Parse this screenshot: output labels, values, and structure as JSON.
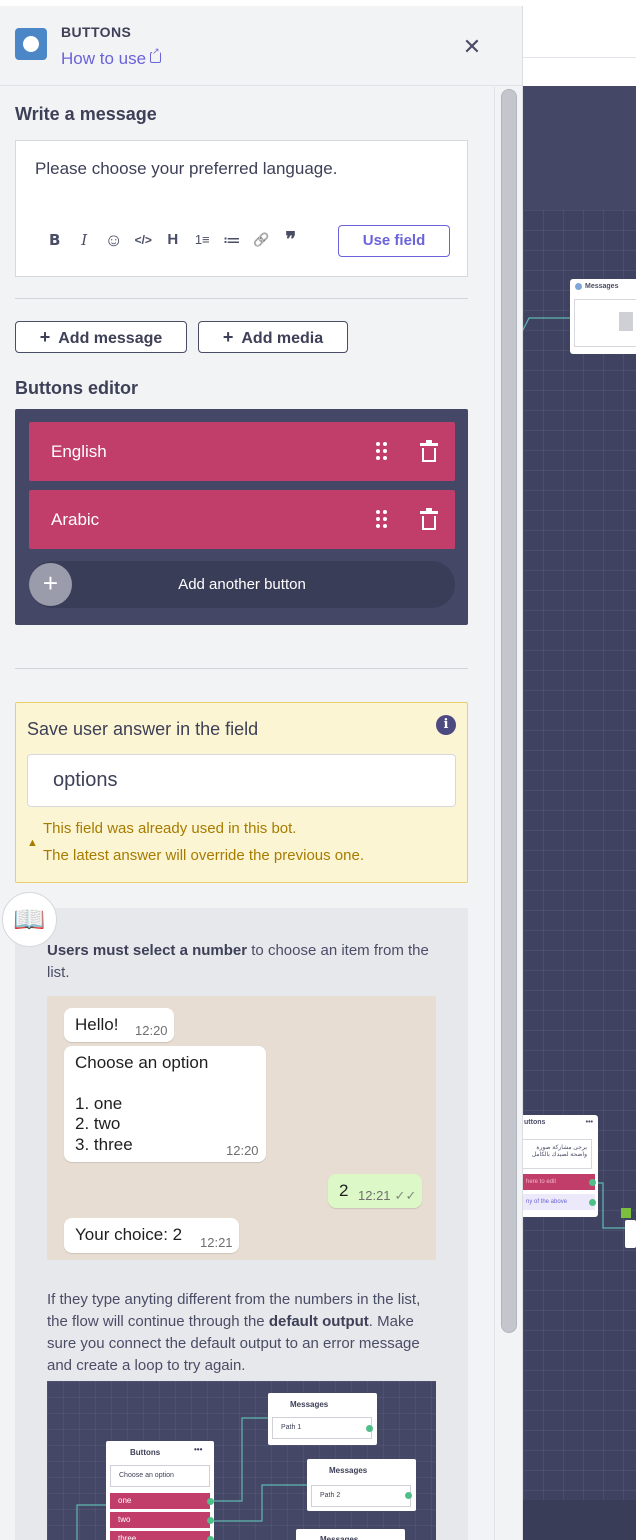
{
  "panel": {
    "title": "BUTTONS",
    "how_to_use": "How to use"
  },
  "message": {
    "section_label": "Write a message",
    "text": "Please choose your preferred language.",
    "toolbar": [
      "B",
      "I",
      "☺",
      "</>",
      "H",
      "1≡",
      "≔",
      "🔗",
      "❞"
    ],
    "use_field": "Use field"
  },
  "actions": {
    "add_message": "Add message",
    "add_media": "Add media"
  },
  "buttons_editor": {
    "label": "Buttons editor",
    "buttons": [
      {
        "label": "English"
      },
      {
        "label": "Arabic"
      }
    ],
    "add_another": "Add another button"
  },
  "save_answer": {
    "title": "Save user answer in the field",
    "field_value": "options",
    "warning_line1": "This field was already used in this bot.",
    "warning_line2": "The latest answer will override the previous one."
  },
  "help": {
    "intro_bold": "Users must select a number",
    "intro_rest": " to choose an item from the list.",
    "chat": {
      "msg1": "Hello!",
      "msg1_time": "12:20",
      "msg2_title": "Choose an option",
      "msg2_items": [
        "1. one",
        "2. two",
        "3. three"
      ],
      "msg2_time": "12:20",
      "reply": "2",
      "reply_time": "12:21",
      "msg3": "Your choice: 2",
      "msg3_time": "12:21"
    },
    "para2_a": "If they type anyting different from the numbers in the list, the flow will continue through the ",
    "para2_bold1": "default output",
    "para2_b": ". Make sure you connect the default output to an error message and create a loop to try again.",
    "flow": {
      "buttons_node_title": "Buttons",
      "buttons_node_text": "Choose an option",
      "rows": [
        "one",
        "two",
        "three"
      ],
      "messages_title": "Messages",
      "path1": "Path 1",
      "path2": "Path 2"
    }
  },
  "canvas": {
    "messages_node_title": "Messages",
    "buttons_node_title": "uttons",
    "buttons_node_text": "يرجى مشاركة صورة واضحة لصيدك بالكامل",
    "row1": "here to edit",
    "row2": "ny of the above"
  },
  "colors": {
    "accent": "#6b63d9",
    "button_row": "#c13e6a",
    "editor_bg": "#444866",
    "warning_bg": "#fcf5d3",
    "warning_text": "#a67c00"
  }
}
